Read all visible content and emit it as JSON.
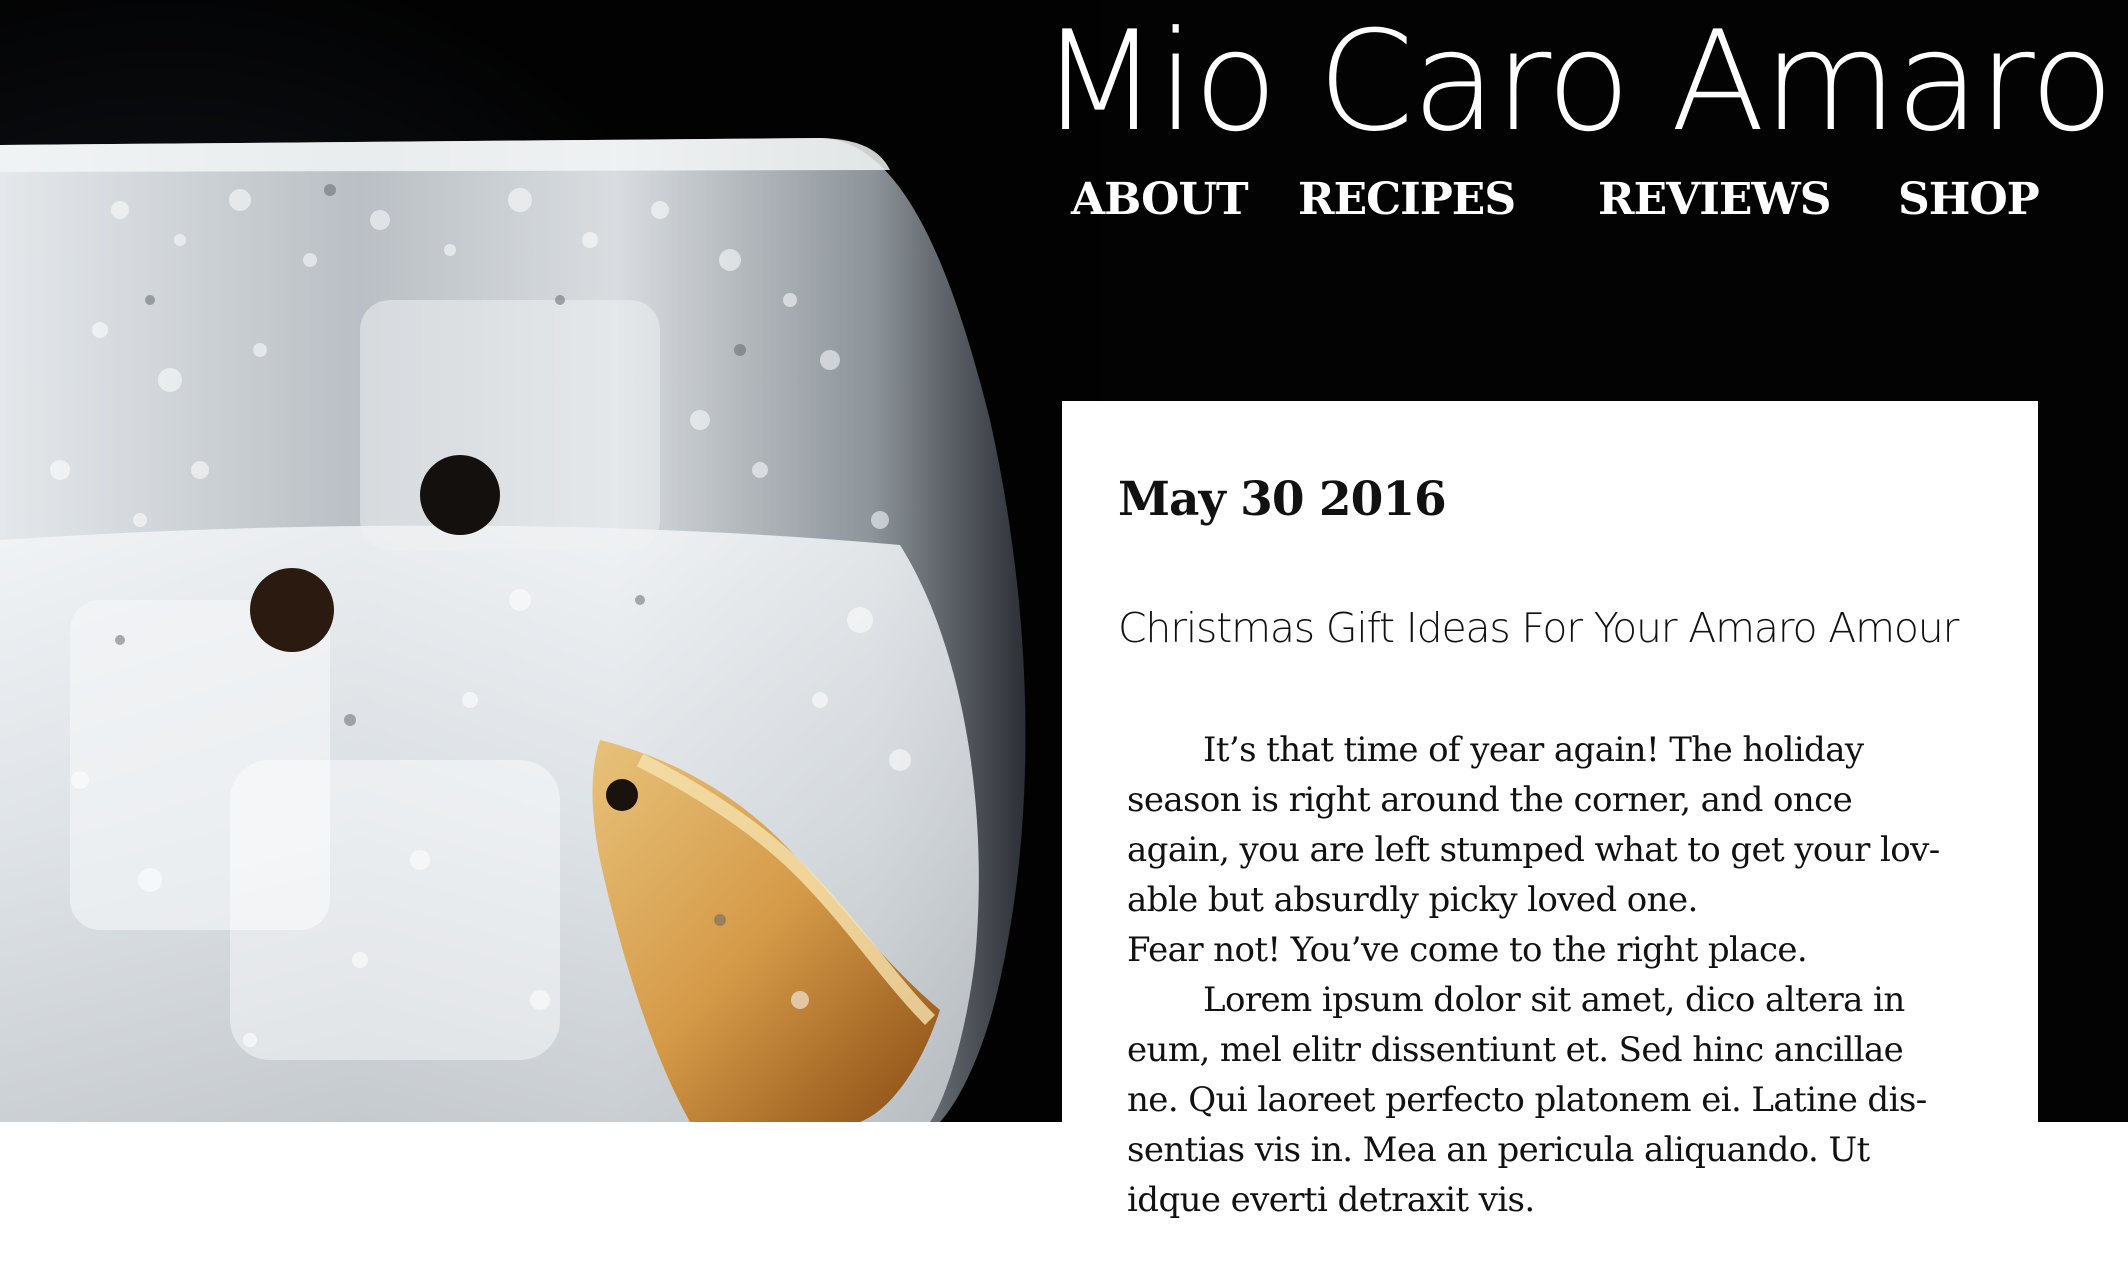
{
  "site": {
    "title": "Mio Caro Amaro"
  },
  "nav": {
    "items": [
      {
        "label": "ABOUT"
      },
      {
        "label": "RECIPES"
      },
      {
        "label": "REVIEWS"
      },
      {
        "label": "SHOP"
      }
    ]
  },
  "post": {
    "date": "May 30 2016",
    "title": "Christmas Gift Ideas For Your Amaro Amour",
    "paragraphs": [
      "It’s that time of year again! The holiday\nseason is right around the corner, and once\nagain, you are left stumped what to get your lov-\nable but absurdly picky loved one.",
      "Fear not! You’ve come to the right place.",
      "Lorem ipsum dolor sit amet, dico altera in\neum, mel elitr dissentiunt et. Sed hinc ancillae\nne. Qui laoreet perfecto platonem ei. Latine dis-\nsentias vis in. Mea an pericula aliquando. Ut\nidque everti detraxit vis."
    ]
  },
  "hero_image": {
    "subject": "cocktail-glass-with-ice-and-orange-slice-photo",
    "colors": {
      "background": "#030303",
      "glass": "#c9ced2",
      "ice": "#eef1f3",
      "orange": "#c98a3a"
    }
  }
}
